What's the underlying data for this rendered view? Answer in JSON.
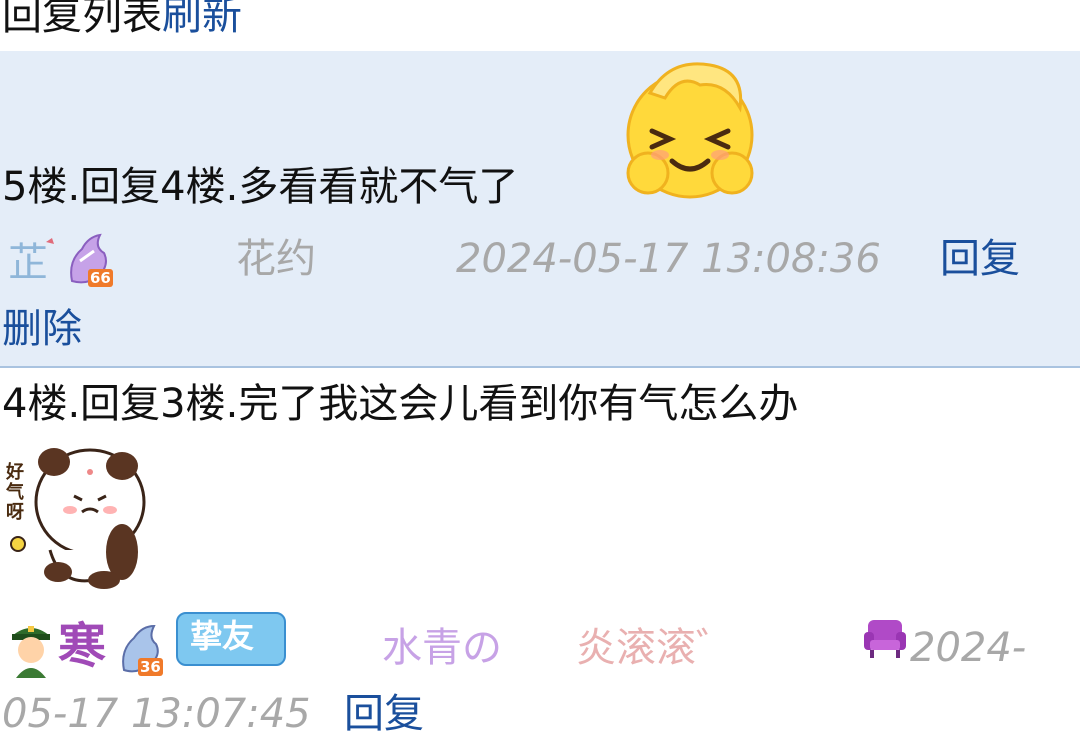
{
  "header": {
    "title": "回复列表",
    "refresh": "刷新"
  },
  "replies": [
    {
      "content": "5楼.回复4楼.多看看就不气了",
      "badges": {
        "level": "66"
      },
      "username": "花约",
      "timestamp": "2024-05-17 13:08:36",
      "reply_label": "回复",
      "delete_label": "删除"
    },
    {
      "content": "4楼.回复3楼.完了我这会儿看到你有气怎么办",
      "sticker_text": "好气呀",
      "badges": {
        "name_char": "寒",
        "level": "36",
        "friend_tag": "挚友"
      },
      "username_part1": "水青の",
      "username_part2": "炎滚滚゛",
      "timestamp_part1": "2024-",
      "timestamp_part2": "05-17 13:07:45",
      "reply_label": "回复"
    }
  ],
  "colors": {
    "link": "#1a4f9c",
    "highlight_bg": "#e4edf8",
    "meta_gray": "#a8a8a8",
    "name_purple": "#c7a2e6",
    "name_pink": "#e9b0b0"
  }
}
